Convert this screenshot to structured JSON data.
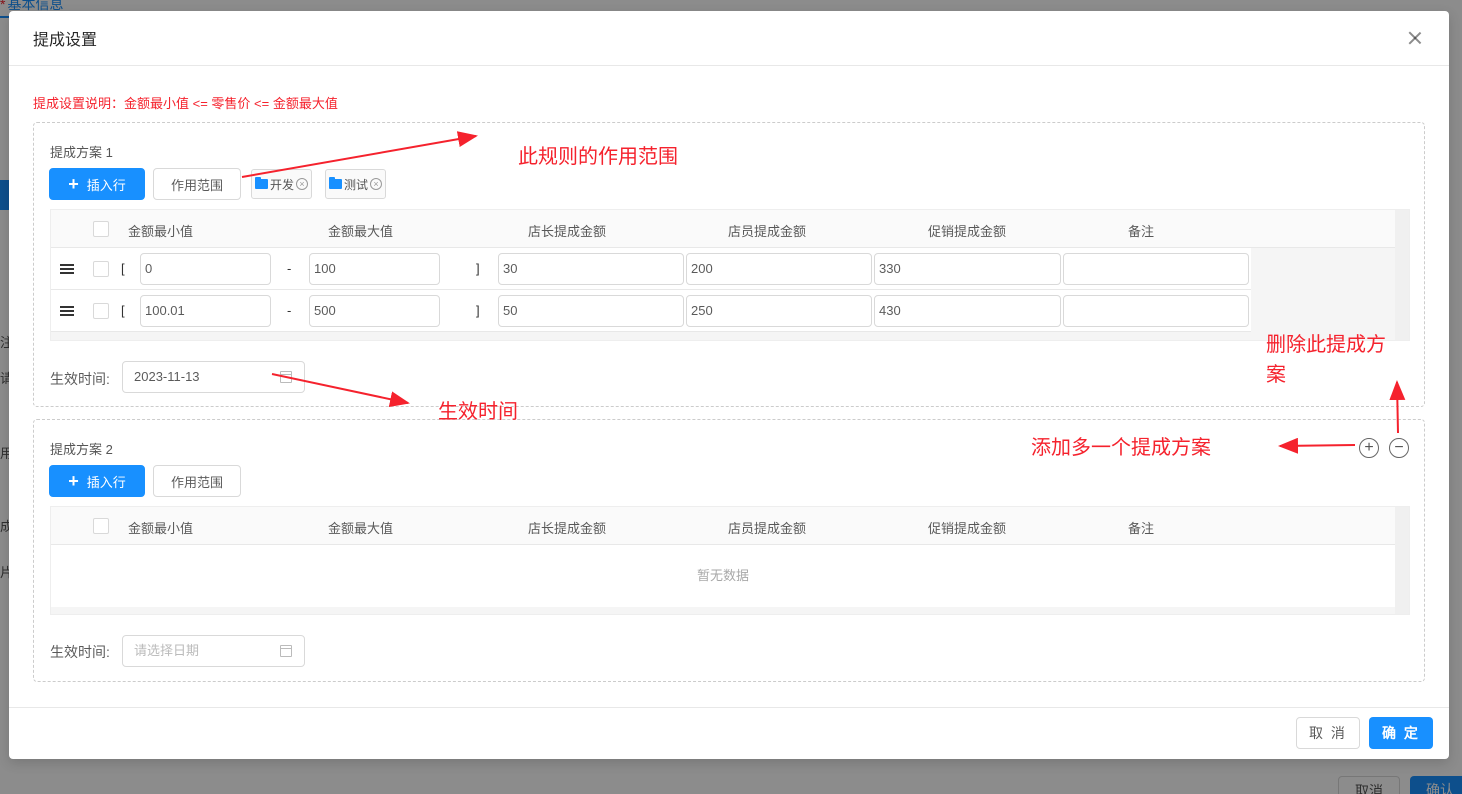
{
  "background": {
    "tab_label": "基本信息",
    "edge_fragments": [
      "注",
      "请",
      "用",
      "成",
      "片"
    ],
    "cancel_label": "取消",
    "ok_label": "确认"
  },
  "modal": {
    "title": "提成设置",
    "hint": "提成设置说明：金额最小值 <= 零售价 <= 金额最大值",
    "footer": {
      "cancel_label": "取 消",
      "ok_label": "确 定"
    }
  },
  "columns": [
    "金额最小值",
    "金额最大值",
    "店长提成金额",
    "店员提成金额",
    "促销提成金额",
    "备注"
  ],
  "plans": [
    {
      "title": "提成方案 1",
      "insert_label": "插入行",
      "scope_label": "作用范围",
      "tags": [
        "开发",
        "测试"
      ],
      "rows": [
        {
          "open": "[",
          "min": "0",
          "dash": "-",
          "max": "100",
          "close": "]",
          "manager": "30",
          "clerk": "200",
          "promo": "330",
          "note": ""
        },
        {
          "open": "[",
          "min": "100.01",
          "dash": "-",
          "max": "500",
          "close": "]",
          "manager": "50",
          "clerk": "250",
          "promo": "430",
          "note": ""
        }
      ],
      "effective_label": "生效时间:",
      "effective_date": "2023-11-13",
      "date_placeholder": "请选择日期"
    },
    {
      "title": "提成方案 2",
      "insert_label": "插入行",
      "scope_label": "作用范围",
      "tags": [],
      "rows": [],
      "empty_text": "暂无数据",
      "effective_label": "生效时间:",
      "effective_date": "",
      "date_placeholder": "请选择日期"
    }
  ],
  "plan_controls": {
    "add_symbol": "+",
    "remove_symbol": "−"
  },
  "annotations": {
    "scope": "此规则的作用范围",
    "effective": "生效时间",
    "delete_line1": "删除此提成方",
    "delete_line2": "案",
    "add": "添加多一个提成方案"
  },
  "colors": {
    "primary": "#1890ff",
    "danger": "#f5222d"
  }
}
